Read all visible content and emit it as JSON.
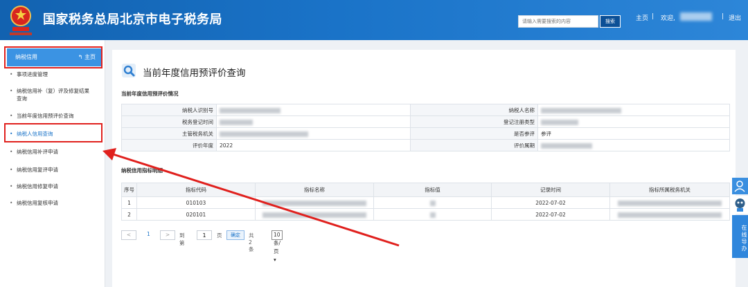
{
  "header": {
    "site_title": "国家税务总局北京市电子税务局",
    "search_placeholder": "请输入需要搜索的内容",
    "search_button": "搜索",
    "nav_home": "主页",
    "nav_sep": "|",
    "nav_welcome": "欢迎,",
    "nav_logout": "退出"
  },
  "sidebar": {
    "head_label": "纳税信用",
    "head_home": "主页",
    "items": [
      {
        "label": "事项进度管理"
      },
      {
        "label": "纳税信用补（复）评及修复结果查询"
      },
      {
        "label": "当前年度信用预评价查询"
      },
      {
        "label": "纳税人信用查询"
      },
      {
        "label": "纳税信用补评申请"
      },
      {
        "label": "纳税信用复评申请"
      },
      {
        "label": "纳税信用修复申请"
      },
      {
        "label": "纳税信用复核申请"
      }
    ]
  },
  "main": {
    "page_title": "当前年度信用预评价查询",
    "section1_title": "当前年度信用预评价情况",
    "info": {
      "taxpayer_id_label": "纳税人识别号",
      "taxpayer_name_label": "纳税人名称",
      "reg_time_label": "税务登记时间",
      "reg_type_label": "登记注册类型",
      "tax_authority_label": "主管税务机关",
      "participate_label": "是否参评",
      "participate_value": "参评",
      "eval_year_label": "评价年度",
      "eval_year_value": "2022",
      "eval_period_label": "评价属期"
    },
    "section2_title": "纳税信用指标明细",
    "grid": {
      "headers": [
        "序号",
        "指标代码",
        "指标名称",
        "指标值",
        "记录时间",
        "指标所属税务机关"
      ],
      "rows": [
        {
          "no": "1",
          "code": "010103",
          "time": "2022-07-02"
        },
        {
          "no": "2",
          "code": "020101",
          "time": "2022-07-02"
        }
      ]
    },
    "pager": {
      "prev": "<",
      "current": "1",
      "next": ">",
      "goto": "到第",
      "page_input": "1",
      "page_unit": "页",
      "confirm": "确定",
      "total": "共 2 条",
      "page_size": "10 条/页"
    }
  },
  "float_bar": {
    "guide_label": "在线导办"
  }
}
